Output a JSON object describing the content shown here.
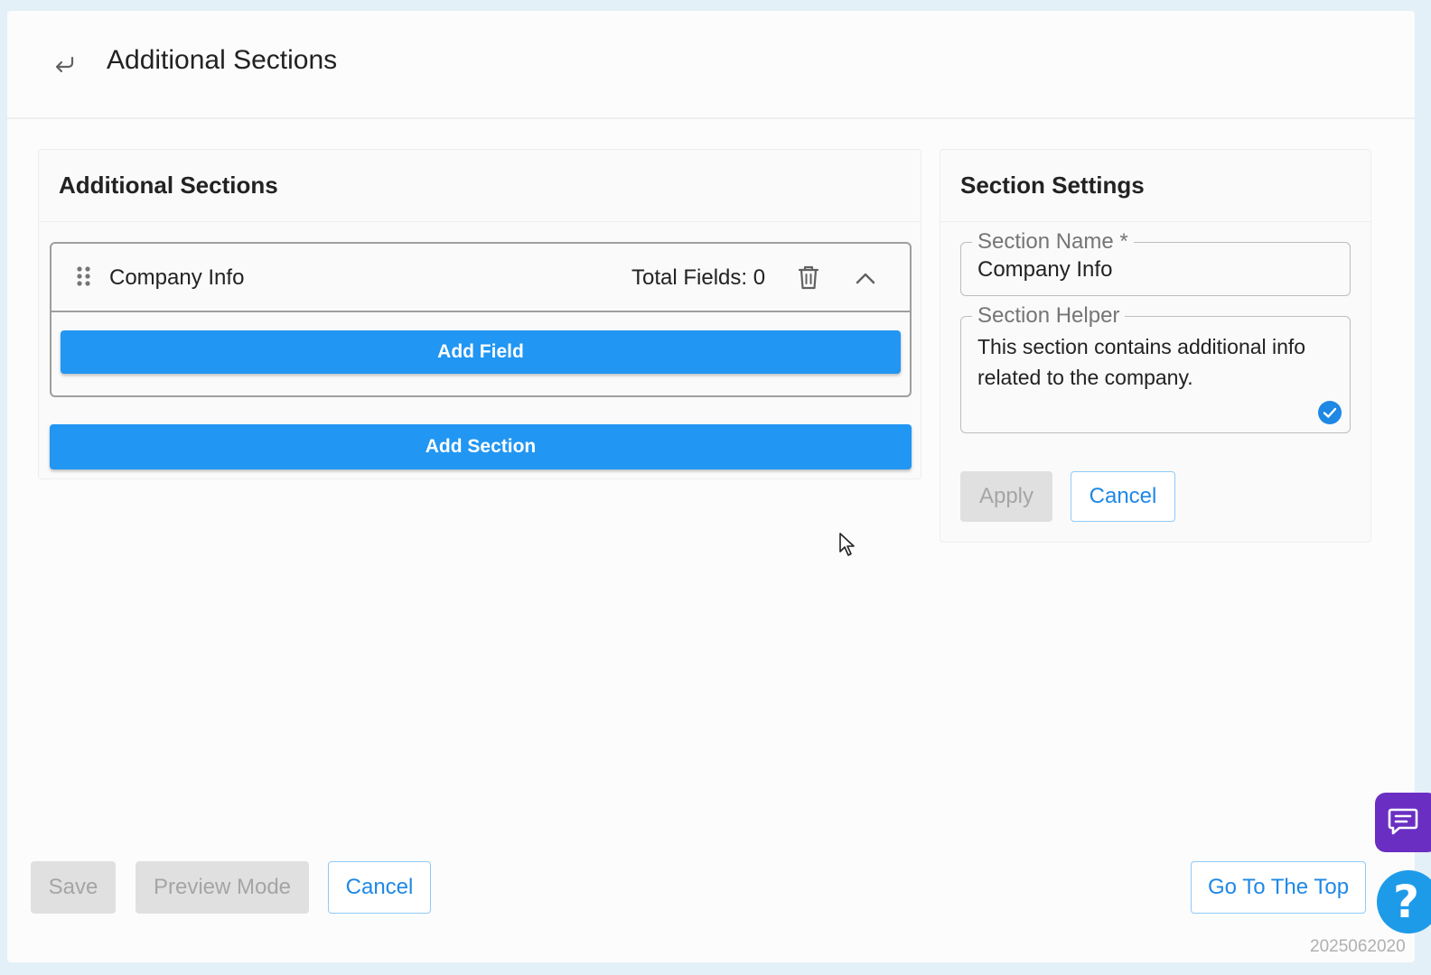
{
  "header": {
    "back_icon": "return-arrow-icon",
    "title": "Additional Sections"
  },
  "left_panel": {
    "title": "Additional Sections",
    "section": {
      "drag_icon": "drag-handle-icon",
      "name": "Company Info",
      "total_fields": "Total Fields: 0",
      "delete_icon": "trash-icon",
      "collapse_icon": "chevron-up-icon",
      "add_field_label": "Add Field"
    },
    "add_section_label": "Add Section"
  },
  "right_panel": {
    "title": "Section Settings",
    "name_field": {
      "label": "Section Name *",
      "value": "Company Info"
    },
    "helper_field": {
      "label": "Section Helper",
      "value": "This section contains additional info related to the company."
    },
    "apply_label": "Apply",
    "cancel_label": "Cancel"
  },
  "footer": {
    "save_label": "Save",
    "preview_label": "Preview Mode",
    "cancel_label": "Cancel",
    "top_label": "Go To The Top"
  },
  "floating": {
    "chat_icon": "chat-bubble-icon",
    "help_label": "?"
  },
  "build_stamp": "2025062020",
  "colors": {
    "primary": "#2196f3",
    "chat": "#6a2fc2",
    "help": "#1e9be8",
    "disabled": "#e0e0e0"
  }
}
